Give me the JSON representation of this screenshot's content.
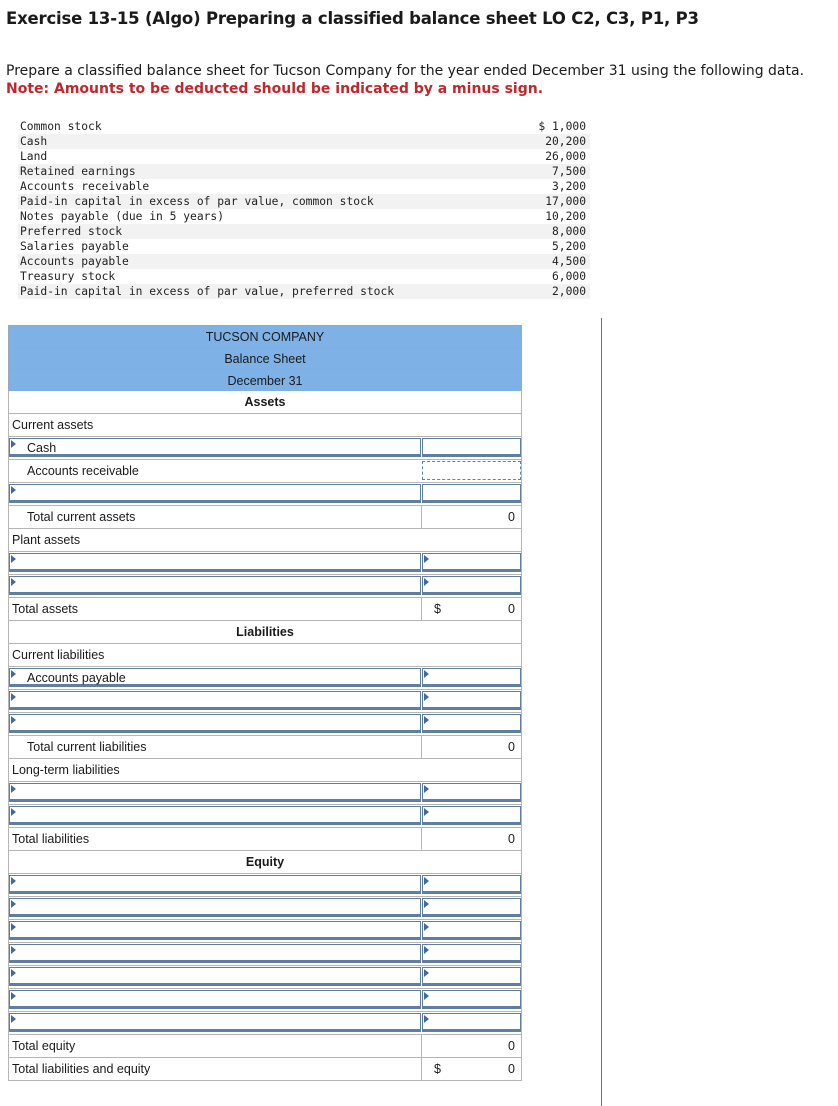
{
  "title": "Exercise 13-15 (Algo) Preparing a classified balance sheet LO C2, C3, P1, P3",
  "instruction": "Prepare a classified balance sheet for Tucson Company for the year ended December 31 using the following data.",
  "note": "Note: Amounts to be deducted should be indicated by a minus sign.",
  "data_items": [
    {
      "label": "Common stock",
      "amount": "$ 1,000"
    },
    {
      "label": "Cash",
      "amount": "20,200"
    },
    {
      "label": "Land",
      "amount": "26,000"
    },
    {
      "label": "Retained earnings",
      "amount": "7,500"
    },
    {
      "label": "Accounts receivable",
      "amount": "3,200"
    },
    {
      "label": "Paid-in capital in excess of par value, common stock",
      "amount": "17,000"
    },
    {
      "label": "Notes payable (due in 5 years)",
      "amount": "10,200"
    },
    {
      "label": "Preferred stock",
      "amount": "8,000"
    },
    {
      "label": "Salaries payable",
      "amount": "5,200"
    },
    {
      "label": "Accounts payable",
      "amount": "4,500"
    },
    {
      "label": "Treasury stock",
      "amount": "6,000"
    },
    {
      "label": "Paid-in capital in excess of par value, preferred stock",
      "amount": "2,000"
    }
  ],
  "sheet": {
    "company": "TUCSON COMPANY",
    "statement": "Balance Sheet",
    "date": "December 31",
    "assets_heading": "Assets",
    "current_assets": "Current assets",
    "cash": "Cash",
    "accounts_receivable": "Accounts receivable",
    "total_current_assets": "Total current assets",
    "total_current_assets_value": "0",
    "plant_assets": "Plant assets",
    "total_assets": "Total assets",
    "total_assets_value": "0",
    "liabilities_heading": "Liabilities",
    "current_liabilities": "Current liabilities",
    "accounts_payable": "Accounts payable",
    "total_current_liabilities": "Total current liabilities",
    "total_current_liabilities_value": "0",
    "long_term_liabilities": "Long-term liabilities",
    "total_liabilities": "Total liabilities",
    "total_liabilities_value": "0",
    "equity_heading": "Equity",
    "total_equity": "Total equity",
    "total_equity_value": "0",
    "total_liabilities_equity": "Total liabilities and equity",
    "total_liabilities_equity_value": "0",
    "currency": "$"
  }
}
